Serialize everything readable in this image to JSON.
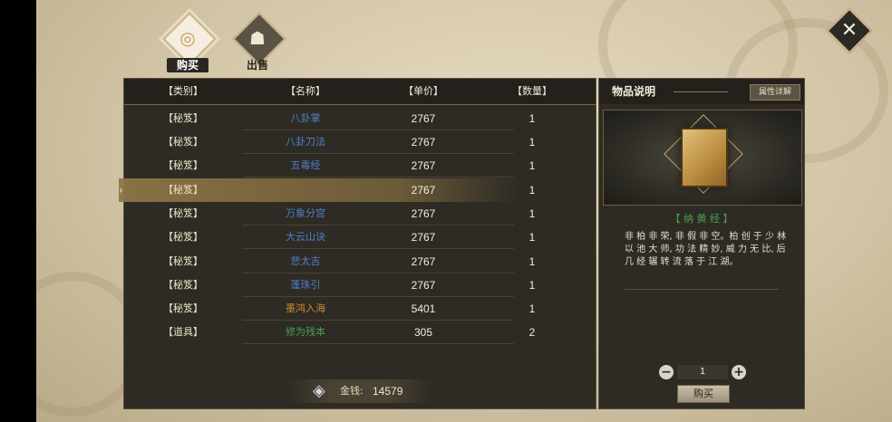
{
  "tabs": [
    {
      "label": "购买",
      "icon": "gold-ingot-icon"
    },
    {
      "label": "出售",
      "icon": "merchant-icon"
    }
  ],
  "close_icon": "close-icon",
  "list": {
    "headers": {
      "type": "【类别】",
      "name": "【名称】",
      "price": "【单价】",
      "qty": "【数量】"
    },
    "rows": [
      {
        "type": "【秘笈】",
        "name": "八卦掌",
        "price": "2767",
        "qty": "1",
        "color": "blue"
      },
      {
        "type": "【秘笈】",
        "name": "八卦刀法",
        "price": "2767",
        "qty": "1",
        "color": "blue"
      },
      {
        "type": "【秘笈】",
        "name": "五毒经",
        "price": "2767",
        "qty": "1",
        "color": "blue"
      },
      {
        "type": "【秘笈】",
        "name": "",
        "price": "2767",
        "qty": "1",
        "color": "blue",
        "selected": true
      },
      {
        "type": "【秘笈】",
        "name": "万象分宫",
        "price": "2767",
        "qty": "1",
        "color": "blue"
      },
      {
        "type": "【秘笈】",
        "name": "大云山诀",
        "price": "2767",
        "qty": "1",
        "color": "blue"
      },
      {
        "type": "【秘笈】",
        "name": "悲太吉",
        "price": "2767",
        "qty": "1",
        "color": "blue"
      },
      {
        "type": "【秘笈】",
        "name": "蓬珠引",
        "price": "2767",
        "qty": "1",
        "color": "blue"
      },
      {
        "type": "【秘笈】",
        "name": "墨鸿入海",
        "price": "5401",
        "qty": "1",
        "color": "orange"
      },
      {
        "type": "【道具】",
        "name": "修为残本",
        "price": "305",
        "qty": "2",
        "color": "green"
      }
    ],
    "selected_marker": "›"
  },
  "gold": {
    "label": "金钱:",
    "value": "14579",
    "icon": "silver-coin-icon"
  },
  "description": {
    "title": "物品说明",
    "detail_button": "属性详解",
    "item_name": "【 纳 黄 经 】",
    "text": "非 柏 非 荣, 非 假 非 空。柏 创 于 少 林 以 池 大 师, 功 法 精 妙, 威 力 无 比, 后 几 经 辗 转 流 落 于 江 湖。",
    "quantity": "1",
    "buy_label": "购买"
  }
}
